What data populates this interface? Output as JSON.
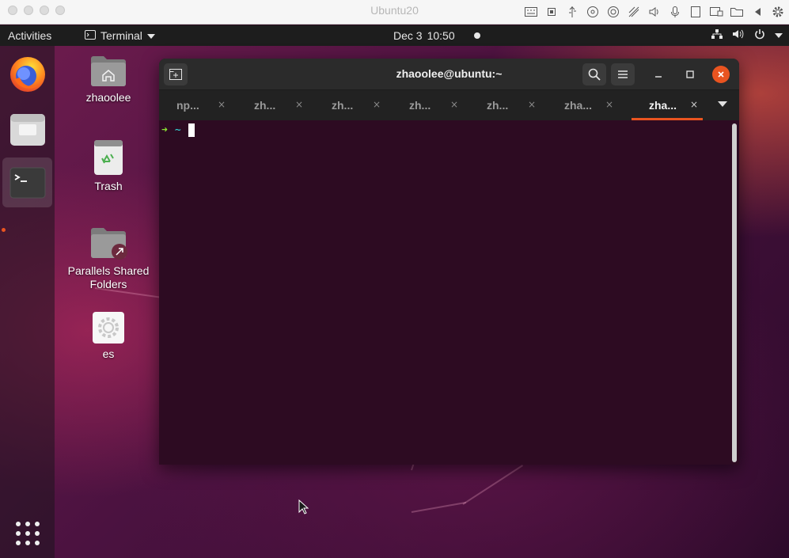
{
  "host": {
    "title": "Ubuntu20",
    "icons": [
      "keyboard-icon",
      "cpu-icon",
      "usb-icon",
      "cd-icon",
      "camera-icon",
      "network-icon",
      "speaker-icon",
      "microphone-icon",
      "printer-icon",
      "display-icon",
      "shared-folder-icon",
      "arrow-left-icon",
      "gear-icon"
    ]
  },
  "topbar": {
    "activities": "Activities",
    "app_name": "Terminal",
    "date": "Dec 3",
    "time": "10:50"
  },
  "desktop_icons": [
    {
      "label": "zhaoolee"
    },
    {
      "label": "Trash"
    },
    {
      "label": "Parallels Shared Folders"
    },
    {
      "label": "es"
    }
  ],
  "terminal": {
    "title": "zhaoolee@ubuntu:~",
    "tabs": [
      {
        "label": "np...",
        "active": false
      },
      {
        "label": "zh...",
        "active": false
      },
      {
        "label": "zh...",
        "active": false
      },
      {
        "label": "zh...",
        "active": false
      },
      {
        "label": "zh...",
        "active": false
      },
      {
        "label": "zha...",
        "active": false
      },
      {
        "label": "zha...",
        "active": true
      }
    ],
    "tab_close_glyph": "×",
    "prompt_arrow": "➜",
    "prompt_dir": "~"
  },
  "colors": {
    "accent": "#e95420",
    "terminal_bg": "#2d0b22",
    "prompt_arrow": "#8ae234",
    "prompt_dir": "#34e2e2"
  }
}
